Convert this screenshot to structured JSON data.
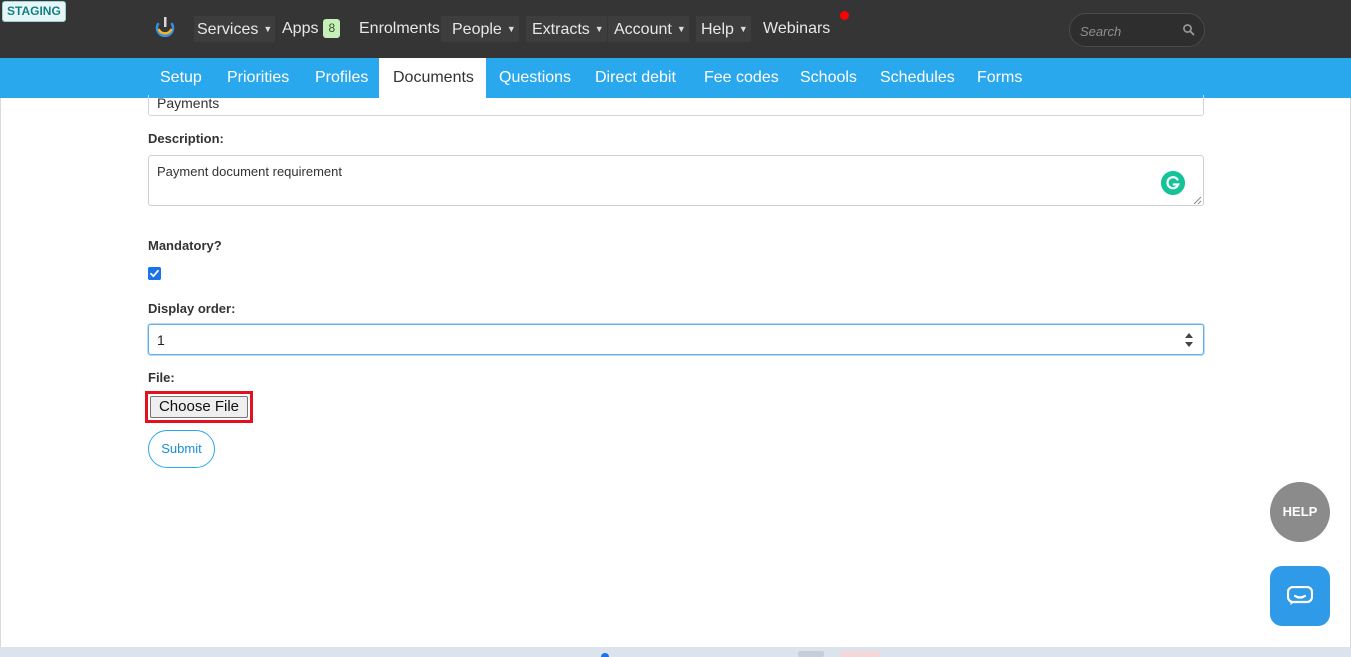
{
  "environment_badge": "STAGING",
  "nav": {
    "items": [
      {
        "label": "Services",
        "dropdown": true
      },
      {
        "label": "Apps",
        "badge": "8",
        "dropdown": false
      },
      {
        "label": "Enrolments",
        "dropdown": false
      },
      {
        "label": "People",
        "dropdown": true
      },
      {
        "label": "Extracts",
        "dropdown": true
      },
      {
        "label": "Account",
        "dropdown": true
      },
      {
        "label": "Help",
        "dropdown": true
      },
      {
        "label": "Webinars",
        "dropdown": false
      }
    ],
    "search_placeholder": "Search"
  },
  "tabs": [
    {
      "label": "Setup"
    },
    {
      "label": "Priorities"
    },
    {
      "label": "Profiles"
    },
    {
      "label": "Documents",
      "active": true
    },
    {
      "label": "Questions"
    },
    {
      "label": "Direct debit"
    },
    {
      "label": "Fee codes"
    },
    {
      "label": "Schools"
    },
    {
      "label": "Schedules"
    },
    {
      "label": "Forms"
    }
  ],
  "form": {
    "label_field_value": "Payments",
    "description_label": "Description:",
    "description_value": "Payment document requirement",
    "mandatory_label": "Mandatory?",
    "mandatory_checked": true,
    "display_order_label": "Display order:",
    "display_order_value": "1",
    "file_label": "File:",
    "file_button": "Choose File",
    "submit_label": "Submit"
  },
  "floating": {
    "help_label": "HELP"
  },
  "colors": {
    "topnav_bg": "#353535",
    "subnav_bg": "#29a8ee",
    "highlight": "#e3101e",
    "help_fab": "#8b8b8b",
    "chat_fab": "#2f9be8"
  },
  "icons": [
    "logo-icon",
    "search-icon",
    "grammarly-icon",
    "checkbox-checked-icon",
    "spinner-icon",
    "chat-icon"
  ]
}
